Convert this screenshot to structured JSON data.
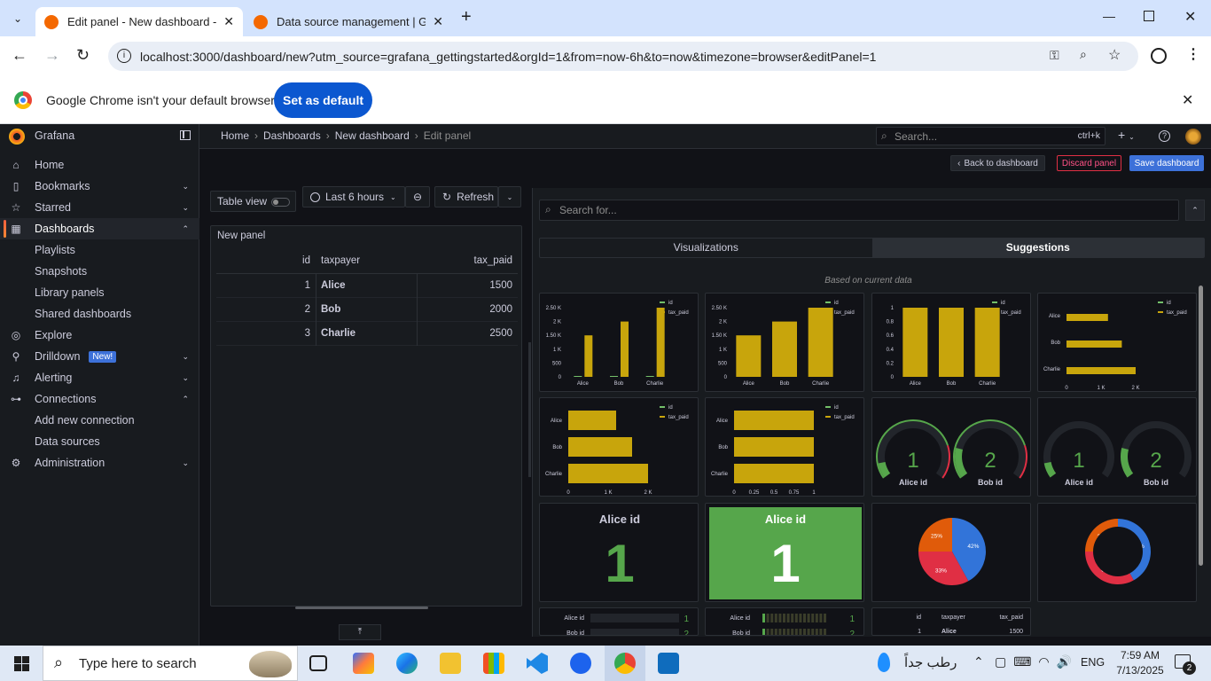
{
  "browser": {
    "tabs": [
      {
        "title": "Edit panel - New dashboard - D",
        "active": true
      },
      {
        "title": "Data source management | Gra",
        "active": false
      }
    ],
    "url": "localhost:3000/dashboard/new?utm_source=grafana_gettingstarted&orgId=1&from=now-6h&to=now&timezone=browser&editPanel=1",
    "infobar": {
      "message": "Google Chrome isn't your default browser",
      "button": "Set as default"
    }
  },
  "grafana": {
    "brand": "Grafana",
    "breadcrumb": [
      "Home",
      "Dashboards",
      "New dashboard",
      "Edit panel"
    ],
    "search": {
      "placeholder": "Search...",
      "shortcut": "ctrl+k"
    },
    "nav": [
      {
        "label": "Home",
        "icon": "home-icon",
        "chevron": ""
      },
      {
        "label": "Bookmarks",
        "icon": "bookmark-icon",
        "chevron": "⌄"
      },
      {
        "label": "Starred",
        "icon": "star-icon",
        "chevron": "⌄"
      },
      {
        "label": "Dashboards",
        "icon": "apps-icon",
        "chevron": "⌃"
      },
      {
        "label": "Playlists",
        "sub": true
      },
      {
        "label": "Snapshots",
        "sub": true
      },
      {
        "label": "Library panels",
        "sub": true
      },
      {
        "label": "Shared dashboards",
        "sub": true
      },
      {
        "label": "Explore",
        "icon": "compass-icon",
        "chevron": ""
      },
      {
        "label": "Drilldown",
        "icon": "drilldown-icon",
        "chevron": "⌄",
        "badge": "New!"
      },
      {
        "label": "Alerting",
        "icon": "bell-icon",
        "chevron": "⌄"
      },
      {
        "label": "Connections",
        "icon": "link-icon",
        "chevron": "⌃"
      },
      {
        "label": "Add new connection",
        "sub": true
      },
      {
        "label": "Data sources",
        "sub": true
      },
      {
        "label": "Administration",
        "icon": "cog-icon",
        "chevron": "⌄"
      }
    ],
    "actions": {
      "back": "Back to dashboard",
      "discard": "Discard panel",
      "save": "Save dashboard"
    },
    "panel_toolbar": {
      "table_view": "Table view",
      "time_range": "Last 6 hours",
      "refresh": "Refresh"
    },
    "panel": {
      "title": "New panel",
      "columns": [
        "id",
        "taxpayer",
        "tax_paid"
      ],
      "rows": [
        [
          "1",
          "Alice",
          "1500"
        ],
        [
          "2",
          "Bob",
          "2000"
        ],
        [
          "3",
          "Charlie",
          "2500"
        ]
      ]
    },
    "viz_picker": {
      "search_placeholder": "Search for...",
      "tabs": [
        "Visualizations",
        "Suggestions"
      ],
      "active_tab": "Suggestions",
      "subtitle": "Based on current data"
    },
    "colors": {
      "accent": "#3d71d9",
      "bar": "#c8a50c",
      "green": "#56a64b",
      "danger": "#e02f44"
    }
  },
  "chart_data": [
    {
      "type": "bar",
      "categories": [
        "Alice",
        "Bob",
        "Charlie"
      ],
      "series": [
        {
          "name": "id",
          "values": [
            1,
            2,
            3
          ]
        },
        {
          "name": "tax_paid",
          "values": [
            1500,
            2000,
            2500
          ]
        }
      ],
      "ylim": [
        0,
        2500
      ],
      "ticks": [
        "0",
        "500",
        "1 K",
        "1.50 K",
        "2 K",
        "2.50 K"
      ]
    },
    {
      "type": "bar",
      "categories": [
        "Alice",
        "Bob",
        "Charlie"
      ],
      "series": [
        {
          "name": "id",
          "values": [
            1,
            2,
            3
          ]
        },
        {
          "name": "tax_paid",
          "values": [
            1500,
            2000,
            2500
          ]
        }
      ],
      "ylim": [
        0,
        2500
      ],
      "ticks": [
        "0",
        "500",
        "1 K",
        "1.50 K",
        "2 K",
        "2.50 K"
      ]
    },
    {
      "type": "bar",
      "categories": [
        "Alice",
        "Bob",
        "Charlie"
      ],
      "series": [
        {
          "name": "id",
          "values": [
            1,
            2,
            3
          ]
        },
        {
          "name": "tax_paid",
          "values": [
            1500,
            2000,
            2500
          ]
        }
      ],
      "ylim": [
        0,
        1
      ],
      "ticks": [
        "0",
        "0.2",
        "0.4",
        "0.6",
        "0.8",
        "1"
      ]
    },
    {
      "type": "bar",
      "orientation": "horizontal",
      "categories": [
        "Alice",
        "Bob",
        "Charlie"
      ],
      "series": [
        {
          "name": "id",
          "values": [
            1,
            2,
            3
          ]
        },
        {
          "name": "tax_paid",
          "values": [
            1500,
            2000,
            2500
          ]
        }
      ],
      "xlim": [
        0,
        2500
      ],
      "ticks": [
        "0",
        "1 K",
        "2 K"
      ]
    },
    {
      "type": "bar",
      "orientation": "horizontal",
      "categories": [
        "Alice",
        "Bob",
        "Charlie"
      ],
      "series": [
        {
          "name": "id",
          "values": [
            1,
            2,
            3
          ]
        },
        {
          "name": "tax_paid",
          "values": [
            1500,
            2000,
            2500
          ]
        }
      ],
      "xlim": [
        0,
        2500
      ],
      "ticks": [
        "0",
        "1 K",
        "2 K"
      ]
    },
    {
      "type": "bar",
      "orientation": "horizontal",
      "categories": [
        "Alice",
        "Bob",
        "Charlie"
      ],
      "series": [
        {
          "name": "id",
          "values": [
            1,
            2,
            3
          ]
        },
        {
          "name": "tax_paid",
          "values": [
            1500,
            2000,
            2500
          ]
        }
      ],
      "xlim": [
        0,
        1
      ],
      "ticks": [
        "0",
        "0.25",
        "0.5",
        "0.75",
        "1"
      ]
    },
    {
      "type": "gauge",
      "items": [
        {
          "label": "Alice id",
          "value": 1
        },
        {
          "label": "Bob id",
          "value": 2
        }
      ]
    },
    {
      "type": "gauge",
      "items": [
        {
          "label": "Alice id",
          "value": 1
        },
        {
          "label": "Bob id",
          "value": 2
        }
      ]
    },
    {
      "type": "stat",
      "label": "Alice id",
      "value": 1
    },
    {
      "type": "stat",
      "label": "Alice id",
      "value": 1
    },
    {
      "type": "pie",
      "slices": [
        {
          "value": 42,
          "label": "42%"
        },
        {
          "value": 33,
          "label": "33%"
        },
        {
          "value": 25,
          "label": "25%"
        }
      ]
    },
    {
      "type": "pie",
      "donut": true,
      "slices": [
        {
          "value": 42,
          "label": "42%"
        },
        {
          "value": 33,
          "label": "33%"
        },
        {
          "value": 25,
          "label": "25%"
        }
      ]
    },
    {
      "type": "bargauge",
      "items": [
        {
          "label": "Alice id",
          "value": 1
        },
        {
          "label": "Bob id",
          "value": 2
        }
      ]
    },
    {
      "type": "bargauge",
      "items": [
        {
          "label": "Alice id",
          "value": 1
        },
        {
          "label": "Bob id",
          "value": 2
        }
      ]
    },
    {
      "type": "table",
      "columns": [
        "id",
        "taxpayer",
        "tax_paid"
      ],
      "rows": [
        [
          "1",
          "Alice",
          "1500"
        ]
      ]
    }
  ],
  "taskbar": {
    "search_placeholder": "Type here to search",
    "weather": "رطب جداً",
    "language": "ENG",
    "time": "7:59 AM",
    "date": "7/13/2025",
    "notifications": "2"
  }
}
